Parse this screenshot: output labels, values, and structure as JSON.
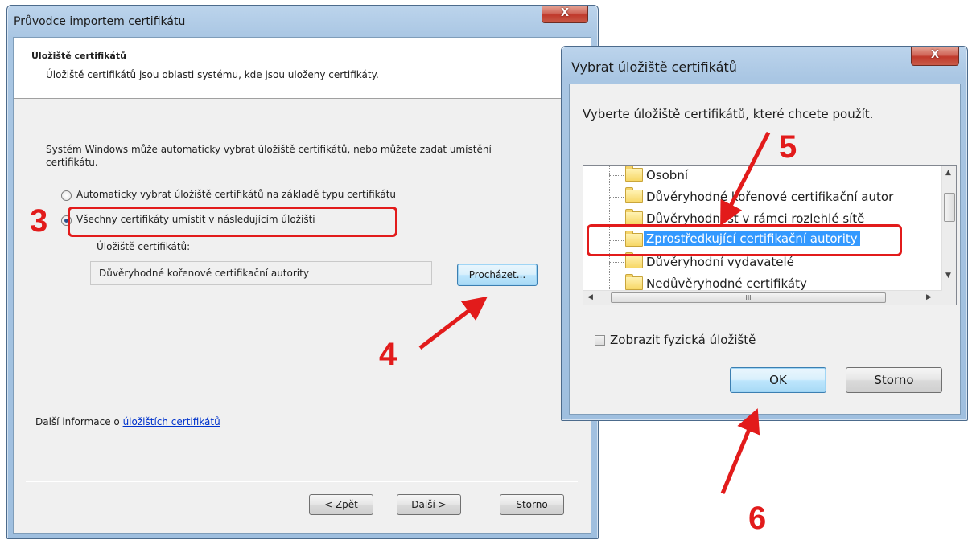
{
  "wizard": {
    "title": "Průvodce importem certifikátu",
    "close_label": "X",
    "heading": "Úložiště certifikátů",
    "subheading": "Úložiště certifikátů jsou oblasti systému, kde jsou uloženy certifikáty.",
    "intro": "Systém Windows může automaticky vybrat úložiště certifikátů, nebo můžete zadat umístění certifikátu.",
    "radio_auto_label": "Automaticky vybrat úložiště certifikátů na základě typu certifikátu",
    "radio_manual_label": "Všechny certifikáty umístit v následujícím úložišti",
    "store_label": "Úložiště certifikátů:",
    "store_value": "Důvěryhodné kořenové certifikační autority",
    "browse_button": "Procházet...",
    "more_info_prefix": "Další informace o",
    "more_info_link": "úložištích certifikátů",
    "back_button": "< Zpět",
    "next_button": "Další >",
    "cancel_button": "Storno"
  },
  "store_dialog": {
    "title": "Vybrat úložiště certifikátů",
    "close_label": "X",
    "prompt": "Vyberte úložiště certifikátů, které chcete použít.",
    "stores": [
      "Osobní",
      "Důvěryhodné kořenové certifikační autor",
      "Důvěryhodnost v rámci rozlehlé sítě",
      "Zprostředkující certifikační autority",
      "Důvěryhodní vydavatelé",
      "Nedůvěryhodné certifikáty"
    ],
    "selected_index": 3,
    "show_physical_label": "Zobrazit fyzická úložiště",
    "ok_button": "OK",
    "cancel_button": "Storno",
    "hscroll_thumb_glyph": "III"
  },
  "annotations": {
    "color": "#e21b1b",
    "step3": "3",
    "step4": "4",
    "step5": "5",
    "step6": "6"
  },
  "colors": {
    "selection": "#3399ff",
    "link": "#0033cc",
    "titlebar": "#a9c6e3"
  }
}
